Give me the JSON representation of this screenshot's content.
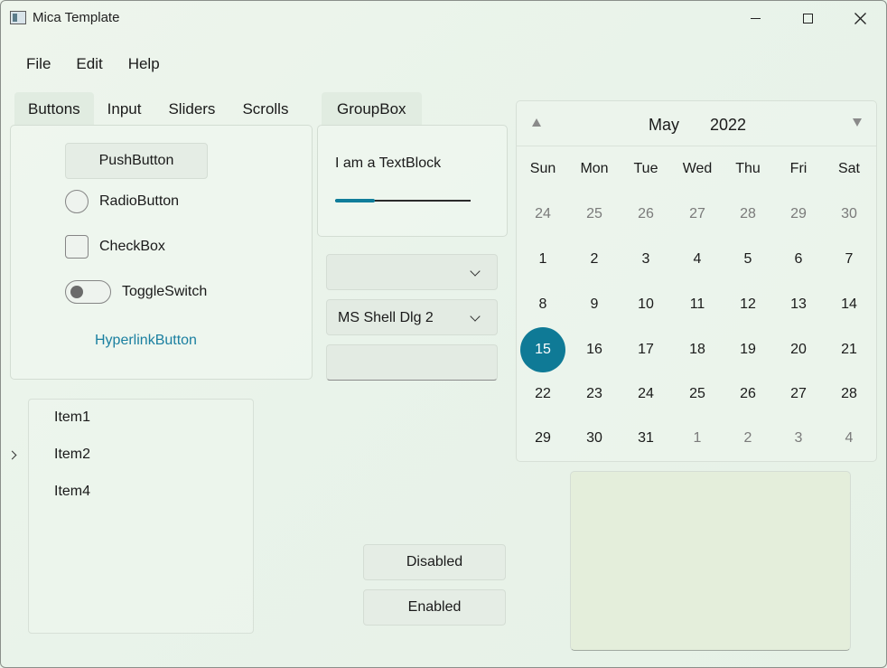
{
  "window": {
    "title": "Mica Template",
    "icon": "app-window-icon"
  },
  "menu": [
    "File",
    "Edit",
    "Help"
  ],
  "tabs": [
    "Buttons",
    "Input",
    "Sliders",
    "Scrolls"
  ],
  "group_tab": "GroupBox",
  "buttons_panel": {
    "push_button": "PushButton",
    "radio_button": "RadioButton",
    "checkbox": "CheckBox",
    "toggle_switch": "ToggleSwitch",
    "hyperlink": "HyperlinkButton"
  },
  "group_box": {
    "text_block": "I am a TextBlock",
    "slider_value": 0.29
  },
  "inputs": {
    "combo_empty_value": "",
    "combo_font_value": "MS Shell Dlg 2",
    "textbox_value": ""
  },
  "tree": [
    "Item1",
    "Item2",
    "Item4"
  ],
  "actions": {
    "disabled": "Disabled",
    "enabled": "Enabled"
  },
  "calendar": {
    "month": "May",
    "year": "2022",
    "weekdays": [
      "Sun",
      "Mon",
      "Tue",
      "Wed",
      "Thu",
      "Fri",
      "Sat"
    ],
    "weeks": [
      [
        "24",
        "25",
        "26",
        "27",
        "28",
        "29",
        "30"
      ],
      [
        "1",
        "2",
        "3",
        "4",
        "5",
        "6",
        "7"
      ],
      [
        "8",
        "9",
        "10",
        "11",
        "12",
        "13",
        "14"
      ],
      [
        "15",
        "16",
        "17",
        "18",
        "19",
        "20",
        "21"
      ],
      [
        "22",
        "23",
        "24",
        "25",
        "26",
        "27",
        "28"
      ],
      [
        "29",
        "30",
        "31",
        "1",
        "2",
        "3",
        "4"
      ]
    ],
    "selected": "15"
  },
  "colors": {
    "accent": "#0f7a96",
    "link": "#1a7fa0"
  }
}
